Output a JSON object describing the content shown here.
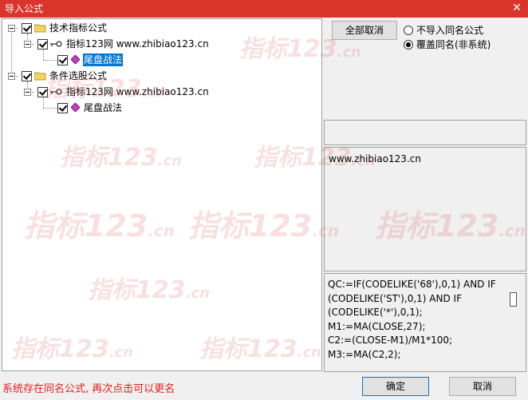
{
  "window": {
    "title": "导入公式",
    "close_glyph": "✕"
  },
  "tree": {
    "groups": [
      {
        "label": "技术指标公式",
        "child": {
          "label": "指标123网 www.zhibiao123.cn",
          "leaf": "尾盘战法",
          "leaf_selected": true
        }
      },
      {
        "label": "条件选股公式",
        "child": {
          "label": "指标123网 www.zhibiao123.cn",
          "leaf": "尾盘战法",
          "leaf_selected": false
        }
      }
    ]
  },
  "buttons": {
    "cancel_all": "全部取消",
    "ok": "确定",
    "cancel": "取消"
  },
  "options": [
    {
      "label": "不导入同名公式",
      "selected": false
    },
    {
      "label": "覆盖同名(非系统)",
      "selected": true
    }
  ],
  "info": {
    "url": "www.zhibiao123.cn"
  },
  "code_lines": [
    "QC:=IF(CODELIKE('68'),0,1) AND IF",
    "(CODELIKE('ST'),0,1) AND IF",
    "(CODELIKE('*'),0,1);",
    "M1:=MA(CLOSE,27);",
    "C2:=(CLOSE-M1)/M1*100;",
    "M3:=MA(C2,2);"
  ],
  "status": "系统存在同名公式, 再次点击可以更名",
  "watermark": {
    "text": "指标123",
    "suffix": ".cn"
  },
  "colors": {
    "titlebar": "#d9352b",
    "selection": "#0078d7",
    "status_text": "#e0201a"
  }
}
